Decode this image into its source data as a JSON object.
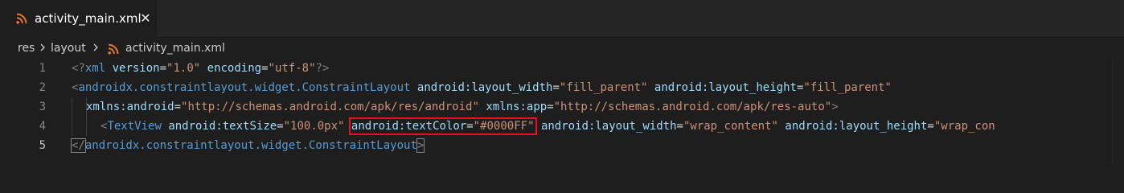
{
  "tab": {
    "label": "activity_main.xml",
    "close_glyph": "✕",
    "icon": "rss-icon",
    "icon_color": "#e37933"
  },
  "breadcrumb": {
    "items": [
      "res",
      "layout",
      "activity_main.xml"
    ]
  },
  "editor": {
    "active_line": 5,
    "line_numbers": [
      "1",
      "2",
      "3",
      "4",
      "5"
    ],
    "lines": {
      "l1": {
        "open": "<?",
        "tag": "xml",
        "a1": "version",
        "eq1": "=",
        "v1": "\"1.0\"",
        "a2": "encoding",
        "eq2": "=",
        "v2": "\"utf-8\"",
        "close": "?>"
      },
      "l2": {
        "open": "<",
        "tag": "androidx.constraintlayout.widget.ConstraintLayout",
        "a1": "android:layout_width",
        "eq1": "=",
        "v1": "\"fill_parent\"",
        "a2": "android:layout_height",
        "eq2": "=",
        "v2": "\"fill_parent\""
      },
      "l3": {
        "a1": "xmlns:android",
        "eq1": "=",
        "v1": "\"http://schemas.android.com/apk/res/android\"",
        "a2": "xmlns:app",
        "eq2": "=",
        "v2": "\"http://schemas.android.com/apk/res-auto\"",
        "close": ">"
      },
      "l4": {
        "open": "<",
        "tag": "TextView",
        "a1": "android:textSize",
        "eq1": "=",
        "v1": "\"100.0px\"",
        "a2": "android:textColor",
        "eq2": "=",
        "v2": "\"#0000FF\"",
        "a3": "android:layout_width",
        "eq3": "=",
        "v3": "\"wrap_content\"",
        "a4": "android:layout_height",
        "eq4": "=",
        "v4": "\"wrap_con"
      },
      "l5": {
        "open": "</",
        "tag": "androidx.constraintlayout.widget.ConstraintLayout",
        "close": ">"
      }
    }
  },
  "colors": {
    "background": "#1e1e1e",
    "tag": "#569cd6",
    "attribute": "#9cdcfe",
    "string": "#ce9178",
    "highlight_box": "#e81123"
  }
}
